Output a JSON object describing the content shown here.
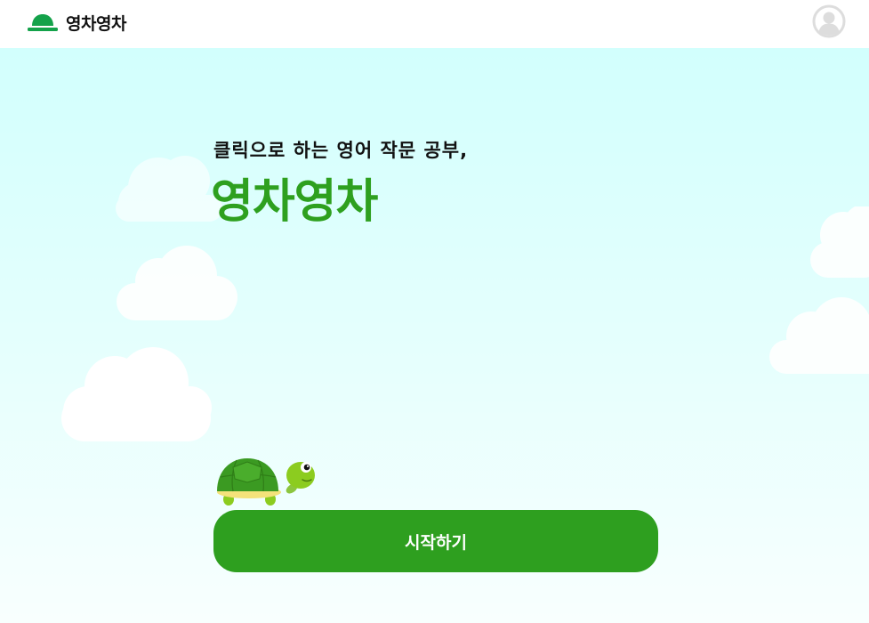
{
  "header": {
    "logo_text": "영차영차",
    "logo_icon": "helmet-icon",
    "avatar_icon": "user-avatar-icon"
  },
  "hero": {
    "subtitle": "클릭으로 하는 영어 작문 공부,",
    "title": "영차영차",
    "start_button_label": "시작하기",
    "mascot": "turtle-illustration"
  },
  "colors": {
    "brand_green": "#2e9f1f",
    "logo_green": "#14a24a",
    "sky_top": "#d2fffd",
    "sky_bottom": "#f8fffe",
    "cloud": "#ffffff",
    "avatar_gray": "#dddddd"
  }
}
